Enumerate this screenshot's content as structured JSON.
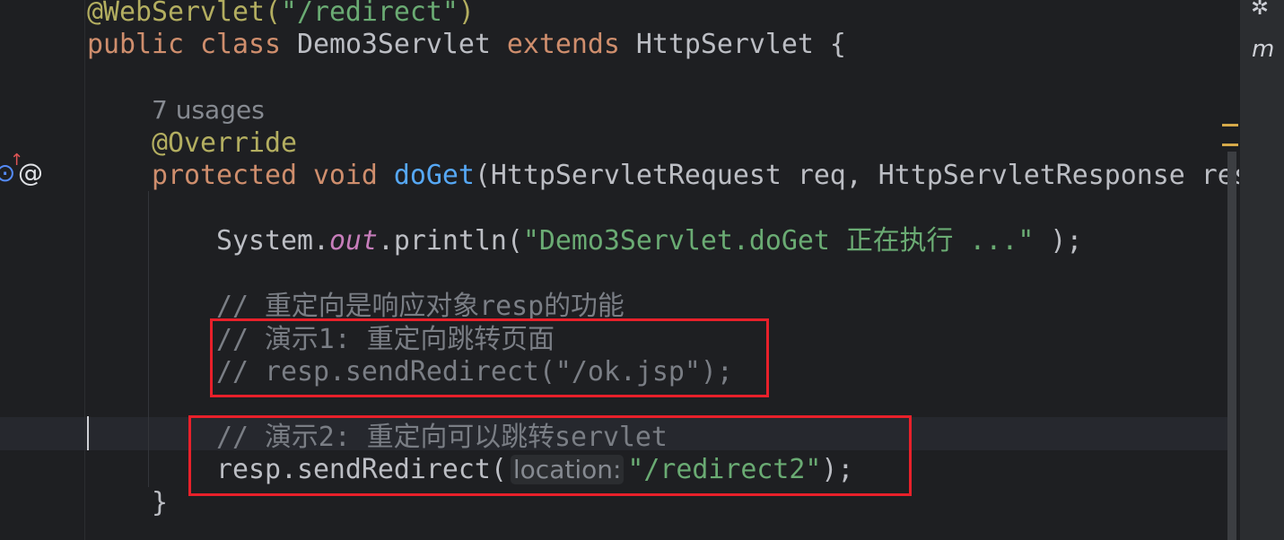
{
  "editor": {
    "lines": [
      [
        {
          "t": "@WebServlet(",
          "c": "ann"
        },
        {
          "t": "\"/redirect\"",
          "c": "str"
        },
        {
          "t": ")",
          "c": "ann"
        }
      ],
      [
        {
          "t": "public class ",
          "c": "kw"
        },
        {
          "t": "Demo3Servlet ",
          "c": ""
        },
        {
          "t": "extends ",
          "c": "kw"
        },
        {
          "t": "HttpServlet {",
          "c": ""
        }
      ],
      [],
      [
        {
          "t": "    ",
          "c": ""
        },
        {
          "t": "7 usages",
          "c": "usages"
        }
      ],
      [
        {
          "t": "    ",
          "c": ""
        },
        {
          "t": "@Override",
          "c": "ann"
        }
      ],
      [
        {
          "t": "    ",
          "c": ""
        },
        {
          "t": "protected void ",
          "c": "kw"
        },
        {
          "t": "doGet",
          "c": "fn"
        },
        {
          "t": "(HttpServletRequest req, HttpServletResponse resp",
          "c": ""
        }
      ],
      [],
      [
        {
          "t": "        System.",
          "c": ""
        },
        {
          "t": "out",
          "c": "st"
        },
        {
          "t": ".println(",
          "c": ""
        },
        {
          "t": "\"Demo3Servlet.doGet 正在执行 ...\"",
          "c": "str"
        },
        {
          "t": " );",
          "c": ""
        }
      ],
      [],
      [
        {
          "t": "        ",
          "c": ""
        },
        {
          "t": "// 重定向是响应对象resp的功能",
          "c": "cm"
        }
      ],
      [
        {
          "t": "        ",
          "c": ""
        },
        {
          "t": "// 演示1: 重定向跳转页面",
          "c": "cm"
        }
      ],
      [
        {
          "t": "        ",
          "c": ""
        },
        {
          "t": "// resp.sendRedirect(\"/ok.jsp\");",
          "c": "cm"
        }
      ],
      [],
      [
        {
          "t": "        ",
          "c": ""
        },
        {
          "t": "// 演示2: 重定向可以跳转servlet",
          "c": "cm"
        }
      ],
      [
        {
          "t": "        resp.sendRedirect(",
          "c": ""
        },
        {
          "t": "location:",
          "c": "hint"
        },
        {
          "t": "\"/redirect2\"",
          "c": "str"
        },
        {
          "t": ");",
          "c": ""
        }
      ],
      [
        {
          "t": "    }",
          "c": ""
        }
      ]
    ]
  },
  "gutter": {
    "icons": [
      "override-method-icon",
      "at-annotation-icon"
    ],
    "at_symbol": "@"
  },
  "right_panel": {
    "icons": [
      "ai-assistant-icon",
      "maven-icon"
    ],
    "maven_label": "m"
  },
  "colors": {
    "highlight_box": "#e8202a",
    "background": "#1e1f22"
  }
}
